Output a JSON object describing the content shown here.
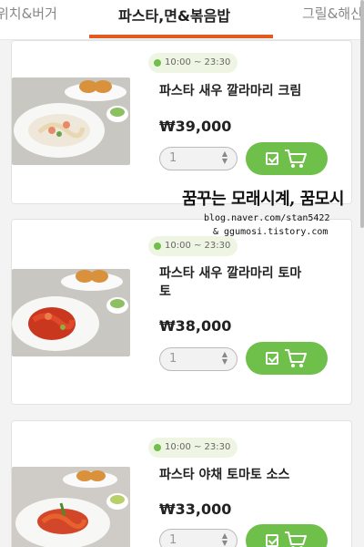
{
  "tabs": [
    {
      "label": "위치&버거"
    },
    {
      "label": "파스타,면&볶음밥"
    },
    {
      "label": "그릴&해산"
    }
  ],
  "products": [
    {
      "hours": "10:00 ~ 23:30",
      "name": "파스타 새우 깔라마리 크림",
      "price": "₩39,000",
      "qty": "1"
    },
    {
      "hours": "10:00 ~ 23:30",
      "name": "파스타 새우 깔라마리 토마토",
      "price": "₩38,000",
      "qty": "1"
    },
    {
      "hours": "10:00 ~ 23:30",
      "name": "파스타 야채 토마토 소스",
      "price": "₩33,000",
      "qty": "1"
    }
  ],
  "watermark": {
    "line1": "꿈꾸는 모래시계, 꿈모시",
    "line2": "blog.naver.com/stan5422",
    "line3": "& ggumosi.tistory.com"
  },
  "icons": {
    "cart": "cart-icon",
    "check": "check-icon",
    "status": "status-dot-icon"
  },
  "colors": {
    "accent": "#e25a1d",
    "green": "#6fbf4b",
    "hours_bg": "#eef6e3"
  }
}
